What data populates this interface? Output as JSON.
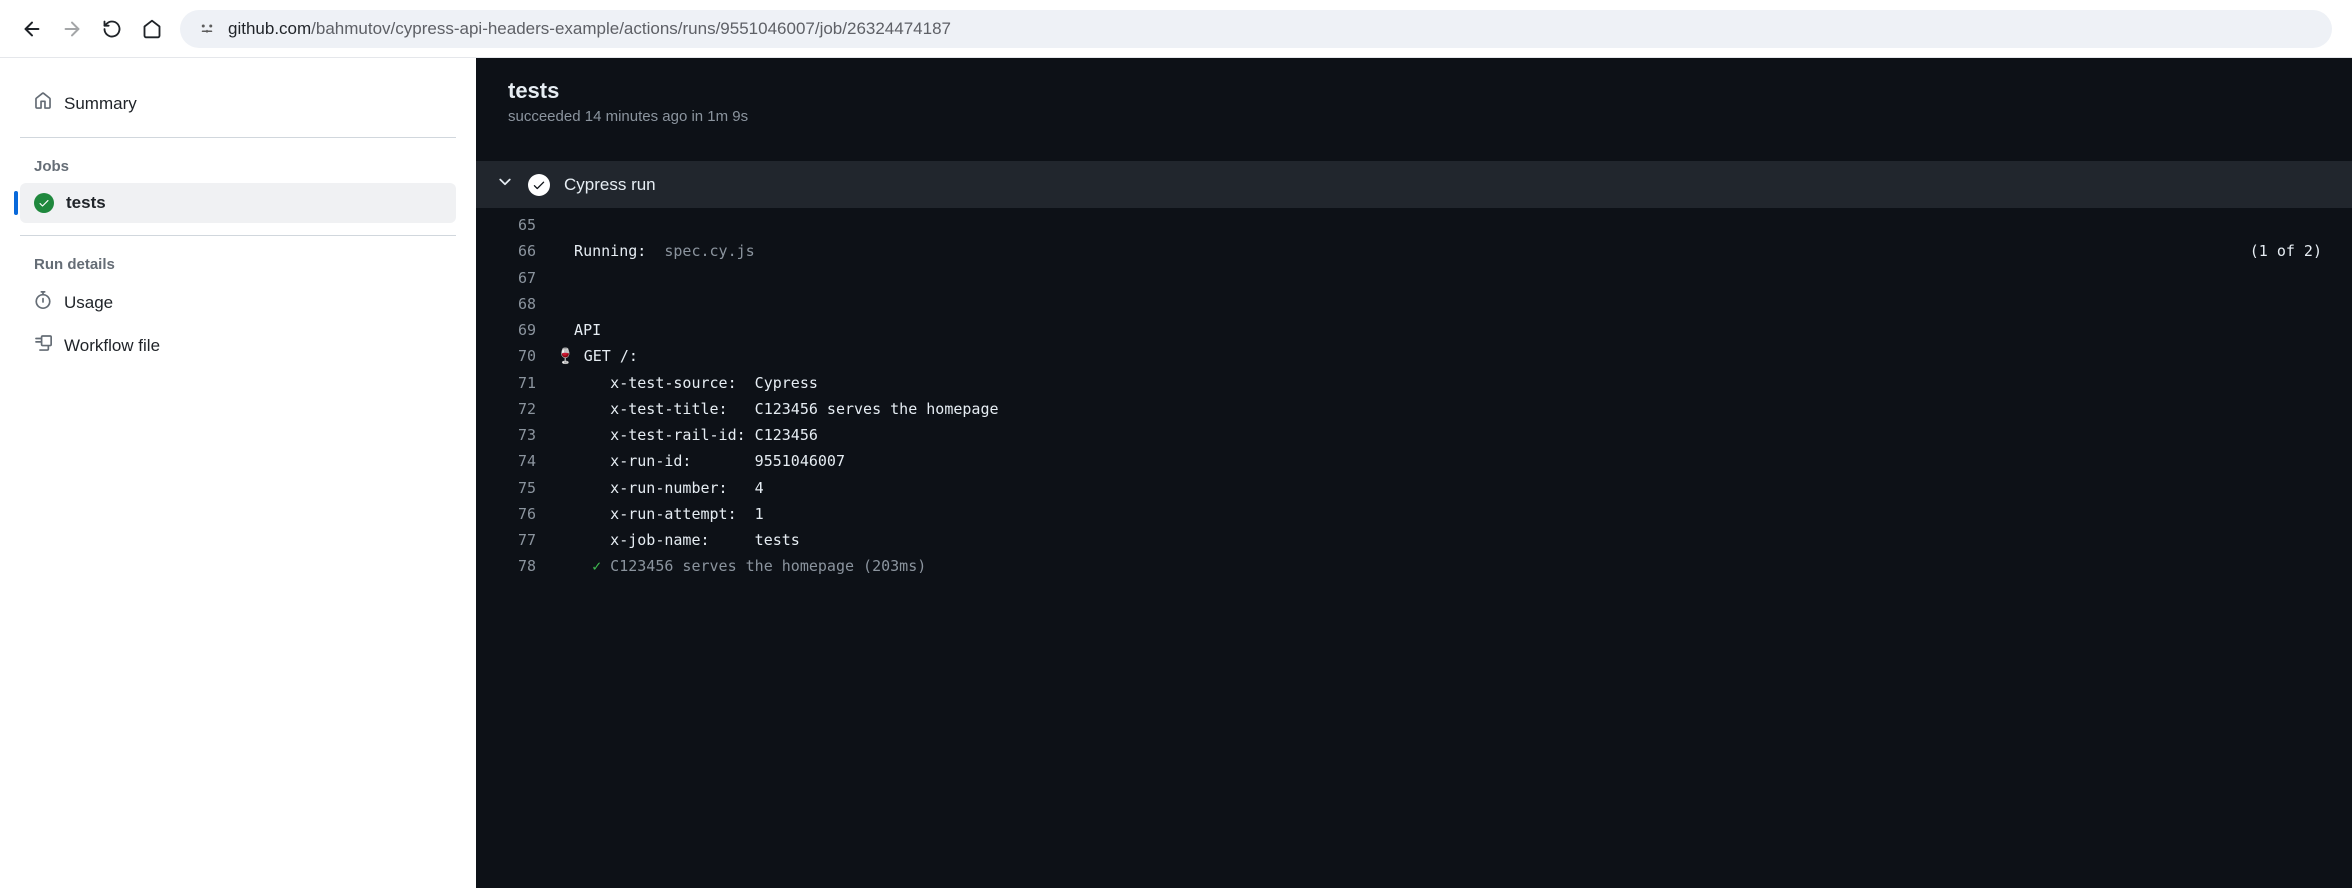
{
  "browser": {
    "url_domain": "github.com",
    "url_path": "/bahmutov/cypress-api-headers-example/actions/runs/9551046007/job/26324474187"
  },
  "sidebar": {
    "summary_label": "Summary",
    "jobs_heading": "Jobs",
    "job_name": "tests",
    "run_details_heading": "Run details",
    "usage_label": "Usage",
    "workflow_file_label": "Workflow file"
  },
  "content": {
    "title": "tests",
    "status": "succeeded 14 minutes ago in 1m 9s",
    "step_title": "Cypress run",
    "progress_text": "(1 of 2)"
  },
  "log": [
    {
      "num": "65",
      "text": ""
    },
    {
      "num": "66",
      "text_prefix": "  Running:  ",
      "text_dim": "spec.cy.js",
      "right": true
    },
    {
      "num": "67",
      "text": ""
    },
    {
      "num": "68",
      "text": ""
    },
    {
      "num": "69",
      "text": "  API"
    },
    {
      "num": "70",
      "text": "🍷 GET /:",
      "emoji": true
    },
    {
      "num": "71",
      "text": "      x-test-source:  Cypress"
    },
    {
      "num": "72",
      "text": "      x-test-title:   C123456 serves the homepage"
    },
    {
      "num": "73",
      "text": "      x-test-rail-id: C123456"
    },
    {
      "num": "74",
      "text": "      x-run-id:       9551046007"
    },
    {
      "num": "75",
      "text": "      x-run-number:   4"
    },
    {
      "num": "76",
      "text": "      x-run-attempt:  1"
    },
    {
      "num": "77",
      "text": "      x-job-name:     tests"
    },
    {
      "num": "78",
      "text_check": "    ✓",
      "text_dim": " C123456 serves the homepage (203ms)"
    }
  ]
}
